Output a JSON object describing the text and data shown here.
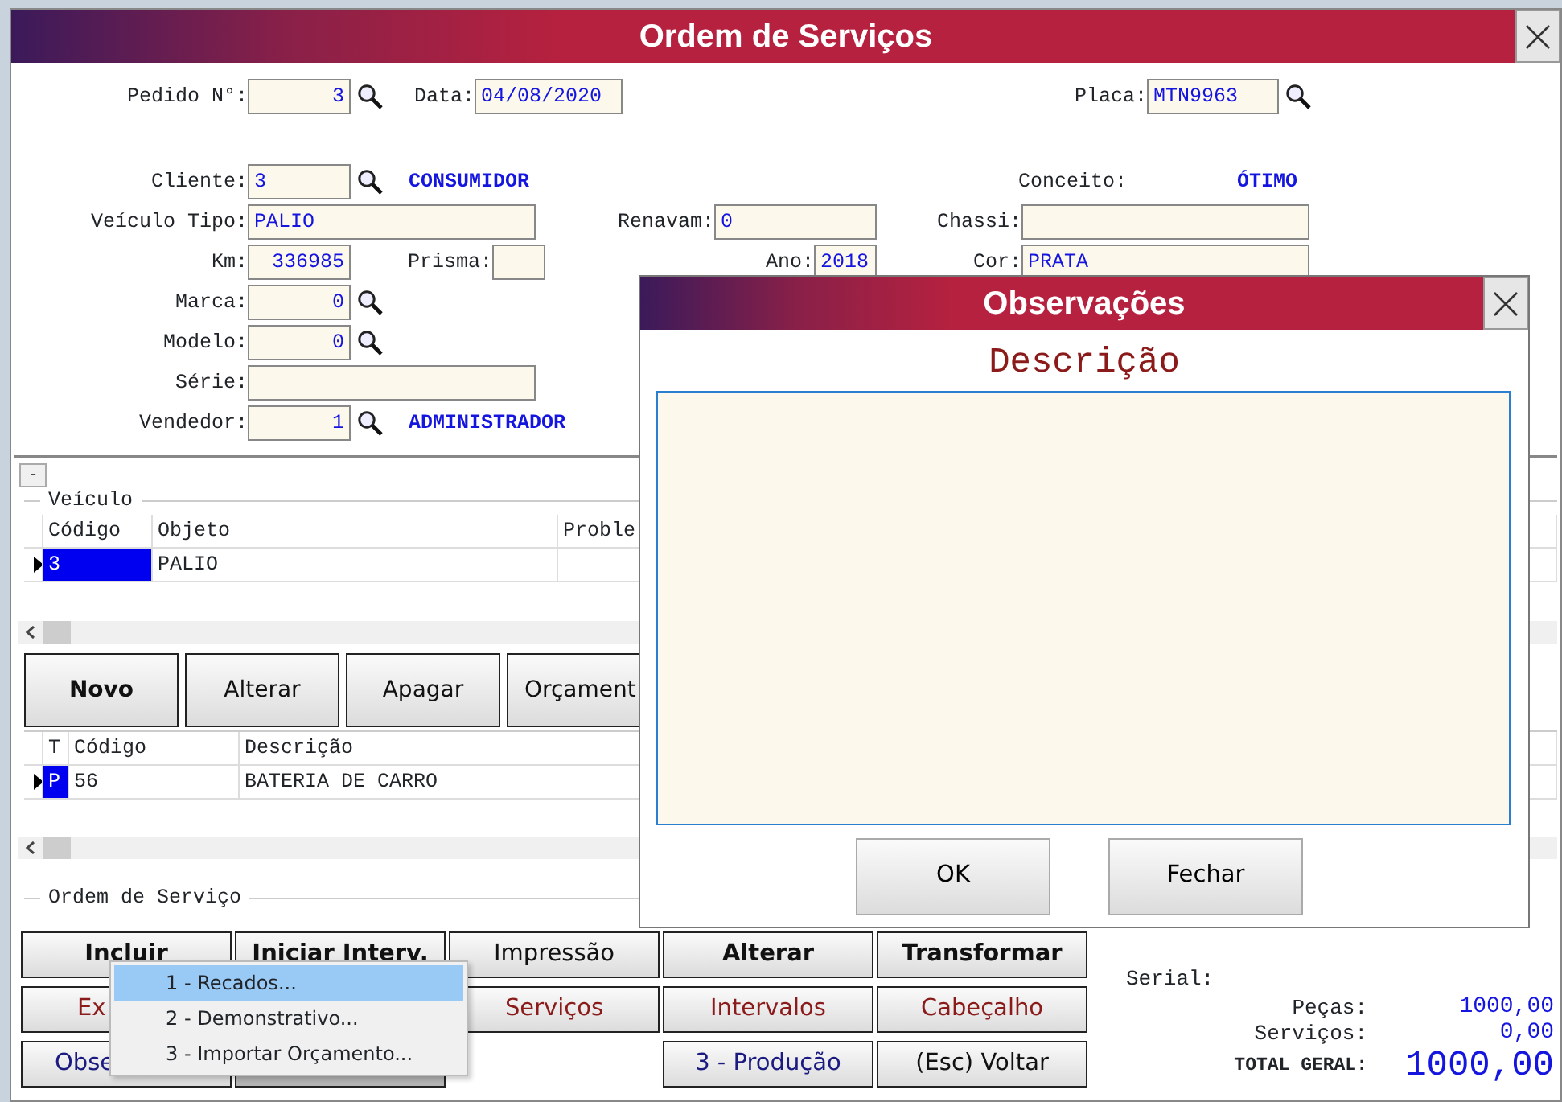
{
  "window": {
    "title": "Ordem de Serviços"
  },
  "form_rows": [
    [
      {
        "kind": "field",
        "label": "Pedido N°:",
        "value": "3",
        "lookup": true
      },
      {
        "kind": "field",
        "label": "Data:",
        "value": "04/08/2020",
        "lookup": false
      },
      {
        "kind": "field",
        "label": "Placa:",
        "value": "MTN9963",
        "lookup": true
      }
    ],
    [
      {
        "kind": "field",
        "label": "Cliente:",
        "value": "3",
        "lookup": true
      },
      {
        "kind": "note",
        "text": "CONSUMIDOR"
      },
      {
        "kind": "caption",
        "text": "Conceito:"
      },
      {
        "kind": "note",
        "text": "ÓTIMO"
      }
    ],
    [
      {
        "kind": "field",
        "label": "Veículo Tipo:",
        "value": "PALIO",
        "lookup": false
      },
      {
        "kind": "field",
        "label": "Renavam:",
        "value": "0",
        "lookup": false
      },
      {
        "kind": "field",
        "label": "Chassi:",
        "lookup": false
      }
    ],
    [
      {
        "kind": "field",
        "label": "Km:",
        "value": "336985",
        "lookup": false
      },
      {
        "kind": "field",
        "label": "Prisma:",
        "lookup": false
      },
      {
        "kind": "field",
        "label": "Ano:",
        "value": "2018",
        "lookup": false
      },
      {
        "kind": "field",
        "label": "Cor:",
        "value": "PRATA",
        "lookup": false
      }
    ],
    [
      {
        "kind": "field",
        "label": "Marca:",
        "value": "0",
        "lookup": true
      }
    ],
    [
      {
        "kind": "field",
        "label": "Modelo:",
        "value": "0",
        "lookup": true
      }
    ],
    [
      {
        "kind": "field",
        "label": "Série:",
        "lookup": false
      }
    ],
    [
      {
        "kind": "field",
        "label": "Vendedor:",
        "value": "1",
        "lookup": true
      },
      {
        "kind": "note",
        "text": "ADMINISTRADOR"
      }
    ]
  ],
  "collapse_button": "-",
  "vehicle_grid": {
    "title": "Veículo",
    "columns": [
      "Código",
      "Objeto",
      "Proble"
    ],
    "rows": [
      {
        "selected": true,
        "cells": [
          "3",
          "PALIO"
        ]
      }
    ]
  },
  "vehicle_buttons": [
    {
      "label": "Novo",
      "bold": true
    },
    {
      "label": "Alterar",
      "bold": false
    },
    {
      "label": "Apagar",
      "bold": false
    },
    {
      "label": "Orçament",
      "bold": false
    }
  ],
  "items_grid": {
    "columns": [
      "T",
      "Código",
      "Descrição"
    ],
    "rows": [
      {
        "selected": true,
        "cells": [
          "P",
          "56",
          "BATERIA DE CARRO"
        ]
      }
    ]
  },
  "order_group": {
    "title": "Ordem de Serviço",
    "buttons": [
      [
        {
          "kind": "bold",
          "label": "Incluir"
        },
        {
          "kind": "bold",
          "label": "Iniciar Interv."
        },
        {
          "kind": "normal",
          "label": "Impressão"
        },
        {
          "kind": "bold",
          "label": "Alterar"
        },
        {
          "kind": "bold",
          "label": "Transformar"
        }
      ],
      [
        {
          "kind": "red",
          "label": "Ex"
        },
        {
          "kind": "blank"
        },
        {
          "kind": "red",
          "label": "Serviços"
        },
        {
          "kind": "red",
          "label": "Intervalos"
        },
        {
          "kind": "red",
          "label": "Cabeçalho"
        }
      ],
      [
        {
          "kind": "navy",
          "label": "Obse"
        },
        {
          "kind": "disabled"
        },
        {
          "kind": "none"
        },
        {
          "kind": "navy",
          "label": "3 - Produção"
        },
        {
          "kind": "normal",
          "label": "(Esc) Voltar"
        }
      ]
    ]
  },
  "totals": {
    "serial_label": "Serial:",
    "lines": [
      {
        "kind": "sub",
        "label": "Peças:",
        "value": "1000,00"
      },
      {
        "kind": "sub",
        "label": "Serviços:",
        "value": "0,00"
      },
      {
        "kind": "total",
        "label": "TOTAL GERAL:",
        "value": "1000,00"
      }
    ]
  },
  "dialog": {
    "title": "Observações",
    "heading": "Descrição",
    "buttons": [
      "OK",
      "Fechar"
    ]
  },
  "context_menu": [
    {
      "label": "1 - Recados...",
      "selected": true
    },
    {
      "label": "2 - Demonstrativo...",
      "selected": false
    },
    {
      "label": "3 - Importar Orçamento...",
      "selected": false
    }
  ]
}
